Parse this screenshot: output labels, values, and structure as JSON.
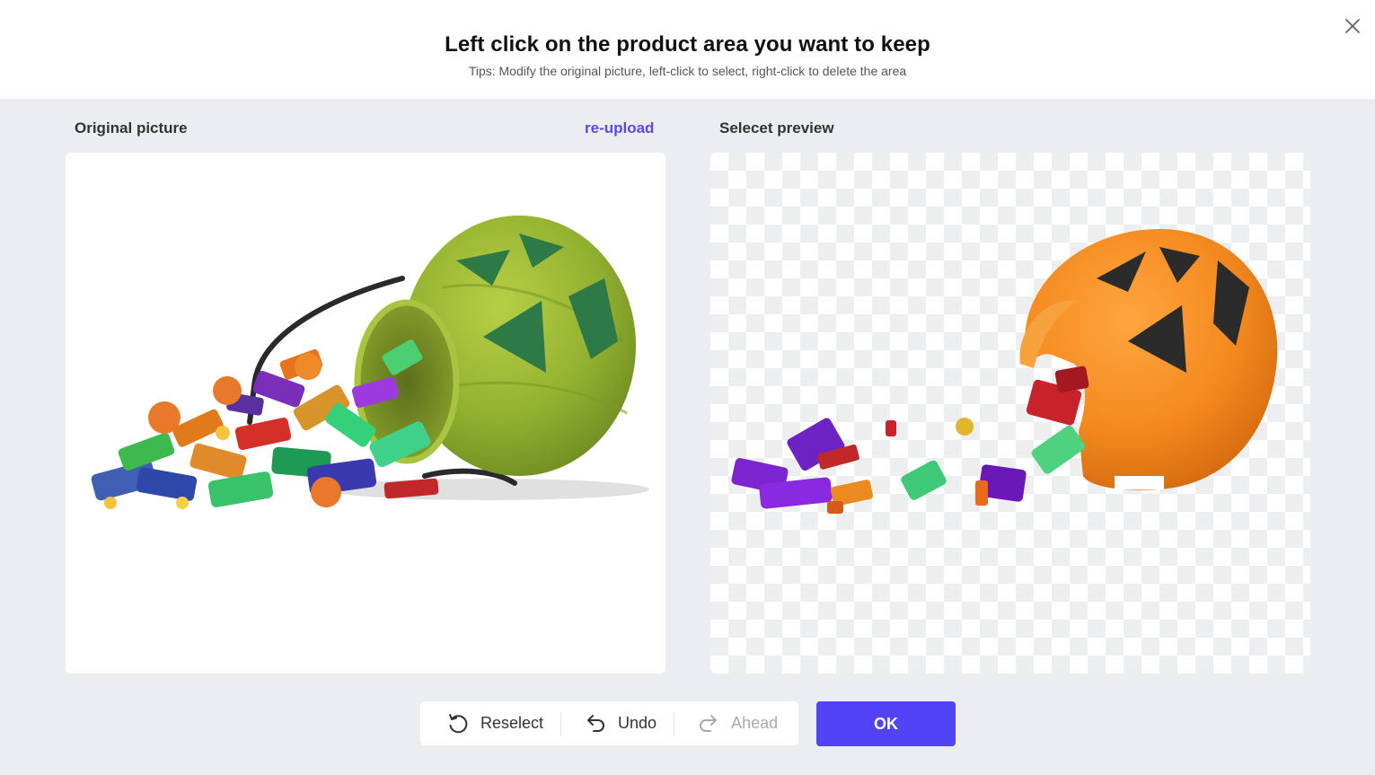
{
  "header": {
    "title": "Left click on the product area you want to keep",
    "tips": "Tips: Modify the original picture, left-click to select, right-click to delete the area"
  },
  "left_panel": {
    "label": "Original picture",
    "reupload_label": "re-upload"
  },
  "right_panel": {
    "label": "Selecet preview"
  },
  "toolbar": {
    "reselect_label": "Reselect",
    "undo_label": "Undo",
    "ahead_label": "Ahead"
  },
  "ok_label": "OK",
  "colors": {
    "accent": "#5343f6",
    "link": "#5a4ae3",
    "background": "#ebedf0",
    "pumpkin_green": "#9dbb33",
    "pumpkin_orange": "#f08a1c"
  },
  "icons": {
    "close": "close-icon",
    "reselect": "rotate-ccw-icon",
    "undo": "undo-icon",
    "ahead": "redo-icon"
  }
}
